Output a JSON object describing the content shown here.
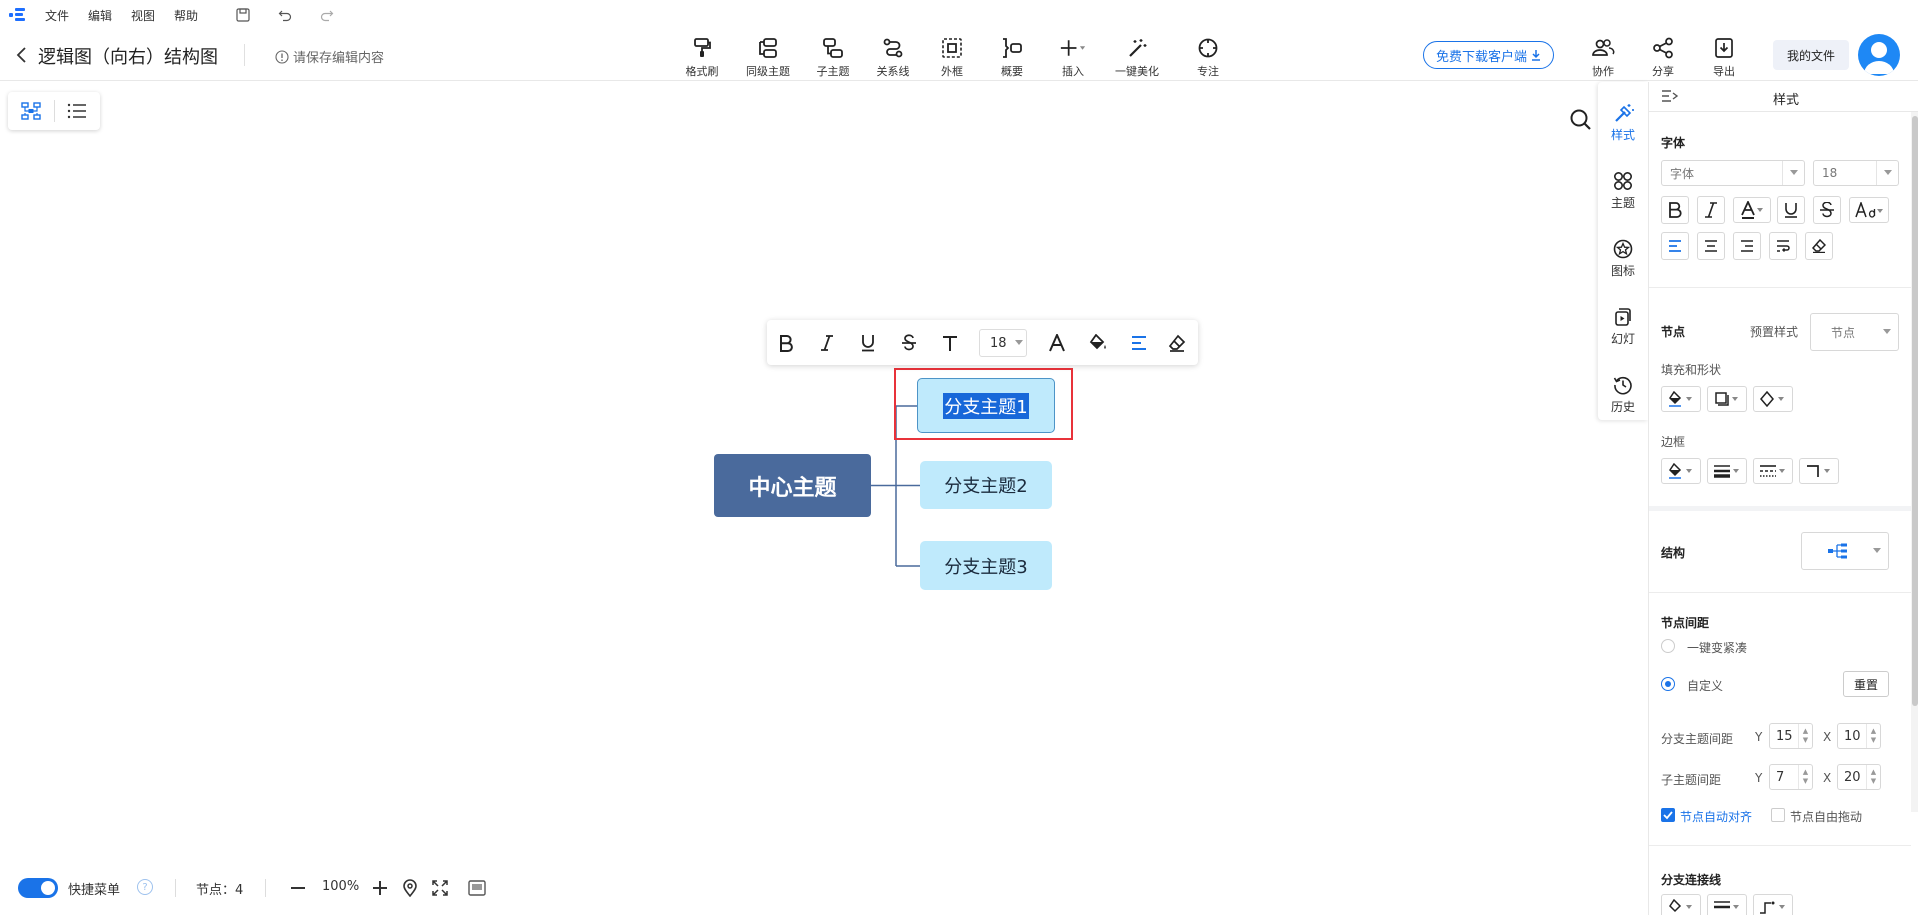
{
  "menu": {
    "items": [
      "文件",
      "编辑",
      "视图",
      "帮助"
    ]
  },
  "header": {
    "title": "逻辑图（向右）结构图",
    "save_note": "请保存编辑内容",
    "download_label": "免费下载客户端",
    "myfiles_label": "我的文件"
  },
  "toolbar": {
    "format_brush": "格式刷",
    "sibling_topic": "同级主题",
    "sub_topic": "子主题",
    "relation_line": "关系线",
    "boundary": "外框",
    "summary": "概要",
    "insert": "插入",
    "beautify": "一键美化",
    "focus": "专注",
    "collaborate": "协作",
    "share": "分享",
    "export": "导出"
  },
  "mindmap": {
    "center": "中心主题",
    "branches": [
      "分支主题1",
      "分支主题2",
      "分支主题3"
    ]
  },
  "float_bar": {
    "font_size": "18"
  },
  "status": {
    "quick_menu": "快捷菜单",
    "nodes_label": "节点：",
    "nodes_count": "4",
    "zoom": "100%"
  },
  "rail": {
    "tabs": [
      "样式",
      "主题",
      "图标",
      "幻灯",
      "历史"
    ]
  },
  "panel": {
    "title": "样式",
    "font_section": "字体",
    "font_family_placeholder": "字体",
    "font_size": "18",
    "node_section": "节点",
    "preset_style_label": "预置样式",
    "preset_style_value": "节点",
    "fill_shape_label": "填充和形状",
    "border_label": "边框",
    "structure_label": "结构",
    "spacing_section": "节点间距",
    "compact_label": "一键变紧凑",
    "custom_label": "自定义",
    "reset_label": "重置",
    "branch_spacing_label": "分支主题间距",
    "sub_spacing_label": "子主题间距",
    "axis_y": "Y",
    "axis_x": "X",
    "branch_y": "15",
    "branch_x": "10",
    "sub_y": "7",
    "sub_x": "20",
    "auto_align_label": "节点自动对齐",
    "free_drag_label": "节点自由拖动",
    "connector_section": "分支连接线"
  },
  "colors": {
    "accent": "#1a73e8",
    "center_node": "#4a6a9c",
    "branch_node": "#bfeafc",
    "selection_frame": "#e8323a",
    "line": "#4a6a9c"
  }
}
